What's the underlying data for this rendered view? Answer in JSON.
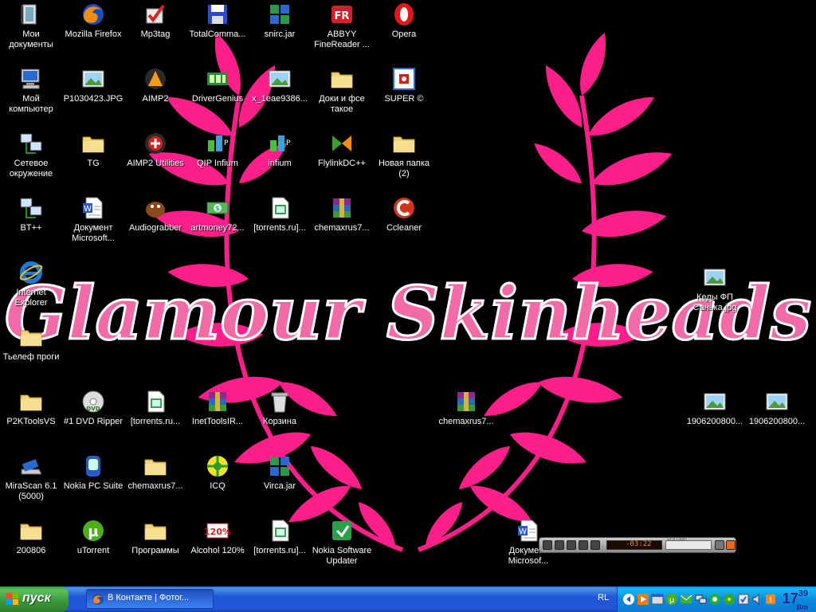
{
  "wallpaper": {
    "text": "Glamour Skinheads",
    "colors": {
      "laurel": "#ff1f8a",
      "text_fill": "#f26aa6",
      "text_outline": "#ffffff"
    }
  },
  "desktop_icons": [
    {
      "label_line1": "Мои",
      "label_line2": "документы",
      "icon": "my-documents-icon"
    },
    {
      "label_line1": "Mozilla Firefox",
      "label_line2": "",
      "icon": "firefox-icon"
    },
    {
      "label_line1": "Mp3tag",
      "label_line2": "",
      "icon": "mp3tag-icon"
    },
    {
      "label_line1": "TotalComma...",
      "label_line2": "",
      "icon": "totalcommander-icon"
    },
    {
      "label_line1": "snirc.jar",
      "label_line2": "",
      "icon": "jar-icon"
    },
    {
      "label_line1": "ABBYY",
      "label_line2": "FineReader ...",
      "icon": "abbyy-icon"
    },
    {
      "label_line1": "Opera",
      "label_line2": "",
      "icon": "opera-icon"
    },
    {
      "label_line1": "Мой",
      "label_line2": "компьютер",
      "icon": "my-computer-icon"
    },
    {
      "label_line1": "P1030423.JPG",
      "label_line2": "",
      "icon": "image-file-icon"
    },
    {
      "label_line1": "AIMP2",
      "label_line2": "",
      "icon": "aimp-icon"
    },
    {
      "label_line1": "DriverGenius",
      "label_line2": "",
      "icon": "drivergenius-icon"
    },
    {
      "label_line1": "x_1eae9386...",
      "label_line2": "",
      "icon": "image-file-icon"
    },
    {
      "label_line1": "Доки и фсе",
      "label_line2": "такое",
      "icon": "folder-icon"
    },
    {
      "label_line1": "SUPER ©",
      "label_line2": "",
      "icon": "super-icon"
    },
    {
      "label_line1": "Сетевое",
      "label_line2": "окружение",
      "icon": "network-icon"
    },
    {
      "label_line1": "TG",
      "label_line2": "",
      "icon": "folder-icon"
    },
    {
      "label_line1": "AIMP2 Utilities",
      "label_line2": "",
      "icon": "aimp-utilities-icon"
    },
    {
      "label_line1": "QIP Infium",
      "label_line2": "",
      "icon": "qip-icon"
    },
    {
      "label_line1": "infium",
      "label_line2": "",
      "icon": "qip-icon"
    },
    {
      "label_line1": "FlylinkDC++",
      "label_line2": "",
      "icon": "flylink-icon"
    },
    {
      "label_line1": "Новая папка",
      "label_line2": "(2)",
      "icon": "folder-icon"
    },
    {
      "label_line1": "BT++",
      "label_line2": "",
      "icon": "network-icon"
    },
    {
      "label_line1": "Документ",
      "label_line2": "Microsoft...",
      "icon": "word-doc-icon"
    },
    {
      "label_line1": "Audiograbber",
      "label_line2": "",
      "icon": "audiograbber-icon"
    },
    {
      "label_line1": "artmoney72...",
      "label_line2": "",
      "icon": "artmoney-icon"
    },
    {
      "label_line1": "[torrents.ru]...",
      "label_line2": "",
      "icon": "image-doc-icon"
    },
    {
      "label_line1": "chemaxrus7...",
      "label_line2": "",
      "icon": "winrar-icon"
    },
    {
      "label_line1": "Ccleaner",
      "label_line2": "",
      "icon": "ccleaner-icon"
    },
    {
      "label_line1": "Internet",
      "label_line2": "Explorer",
      "icon": "ie-icon"
    },
    {
      "label_line1": "Кеды ФП",
      "label_line2": "Санька.jpg",
      "icon": "image-file-icon"
    },
    {
      "label_line1": "Тьелеф проги",
      "label_line2": "",
      "icon": "folder-icon"
    },
    {
      "label_line1": "P2KToolsVS",
      "label_line2": "",
      "icon": "folder-icon"
    },
    {
      "label_line1": "#1 DVD Ripper",
      "label_line2": "",
      "icon": "dvd-icon"
    },
    {
      "label_line1": "[torrents.ru...",
      "label_line2": "",
      "icon": "image-doc-icon"
    },
    {
      "label_line1": "InetToolsIR...",
      "label_line2": "",
      "icon": "winrar-icon"
    },
    {
      "label_line1": "Корзина",
      "label_line2": "",
      "icon": "recycle-bin-icon"
    },
    {
      "label_line1": "chemaxrus7...",
      "label_line2": "",
      "icon": "winrar-icon"
    },
    {
      "label_line1": "1906200800...",
      "label_line2": "",
      "icon": "image-file-icon"
    },
    {
      "label_line1": "1906200800...",
      "label_line2": "",
      "icon": "image-file-icon"
    },
    {
      "label_line1": "MiraScan 6.1",
      "label_line2": "(5000)",
      "icon": "scanner-icon"
    },
    {
      "label_line1": "Nokia PC Suite",
      "label_line2": "",
      "icon": "nokia-suite-icon"
    },
    {
      "label_line1": "chemaxrus7...",
      "label_line2": "",
      "icon": "folder-icon"
    },
    {
      "label_line1": "ICQ",
      "label_line2": "",
      "icon": "icq-icon"
    },
    {
      "label_line1": "Virca.jar",
      "label_line2": "",
      "icon": "jar-icon"
    },
    {
      "label_line1": "200806",
      "label_line2": "",
      "icon": "folder-icon"
    },
    {
      "label_line1": "uTorrent",
      "label_line2": "",
      "icon": "utorrent-icon"
    },
    {
      "label_line1": "Программы",
      "label_line2": "",
      "icon": "folder-icon"
    },
    {
      "label_line1": "Alcohol 120%",
      "label_line2": "",
      "icon": "alcohol-icon"
    },
    {
      "label_line1": "[torrents.ru]...",
      "label_line2": "",
      "icon": "image-doc-icon"
    },
    {
      "label_line1": "Nokia Software",
      "label_line2": "Updater",
      "icon": "nokia-updater-icon"
    },
    {
      "label_line1": "Документ",
      "label_line2": "Microsof...",
      "icon": "word-doc-icon"
    }
  ],
  "player": {
    "time": "-03:22",
    "volume_label": "VOLUME"
  },
  "taskbar": {
    "start_label": "пуск",
    "task_label": "В Контакте | Фотог...",
    "language": "RL",
    "clock_hours": "17",
    "clock_minutes": "39",
    "clock_day": "Вт"
  }
}
